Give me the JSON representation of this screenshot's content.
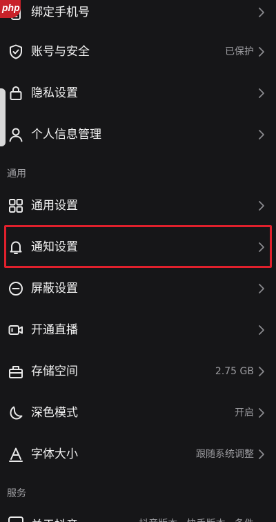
{
  "watermark": "php",
  "rows": [
    {
      "label": "绑定手机号",
      "value": ""
    },
    {
      "label": "账号与安全",
      "value": "已保护"
    },
    {
      "label": "隐私设置",
      "value": ""
    },
    {
      "label": "个人信息管理",
      "value": ""
    },
    {
      "label": "通用设置",
      "value": ""
    },
    {
      "label": "通知设置",
      "value": ""
    },
    {
      "label": "屏蔽设置",
      "value": ""
    },
    {
      "label": "开通直播",
      "value": ""
    },
    {
      "label": "存储空间",
      "value": "2.75 GB"
    },
    {
      "label": "深色模式",
      "value": "开启"
    },
    {
      "label": "字体大小",
      "value": "跟随系统调整"
    }
  ],
  "sections": {
    "general": "通用",
    "services": "服务"
  },
  "bottom_partial": {
    "label": "关于抖音",
    "value": "抖音版本 · 快手版本 · 条件"
  },
  "colors": {
    "background": "#161618",
    "highlight": "#e0202c",
    "watermark": "#c8222a"
  }
}
